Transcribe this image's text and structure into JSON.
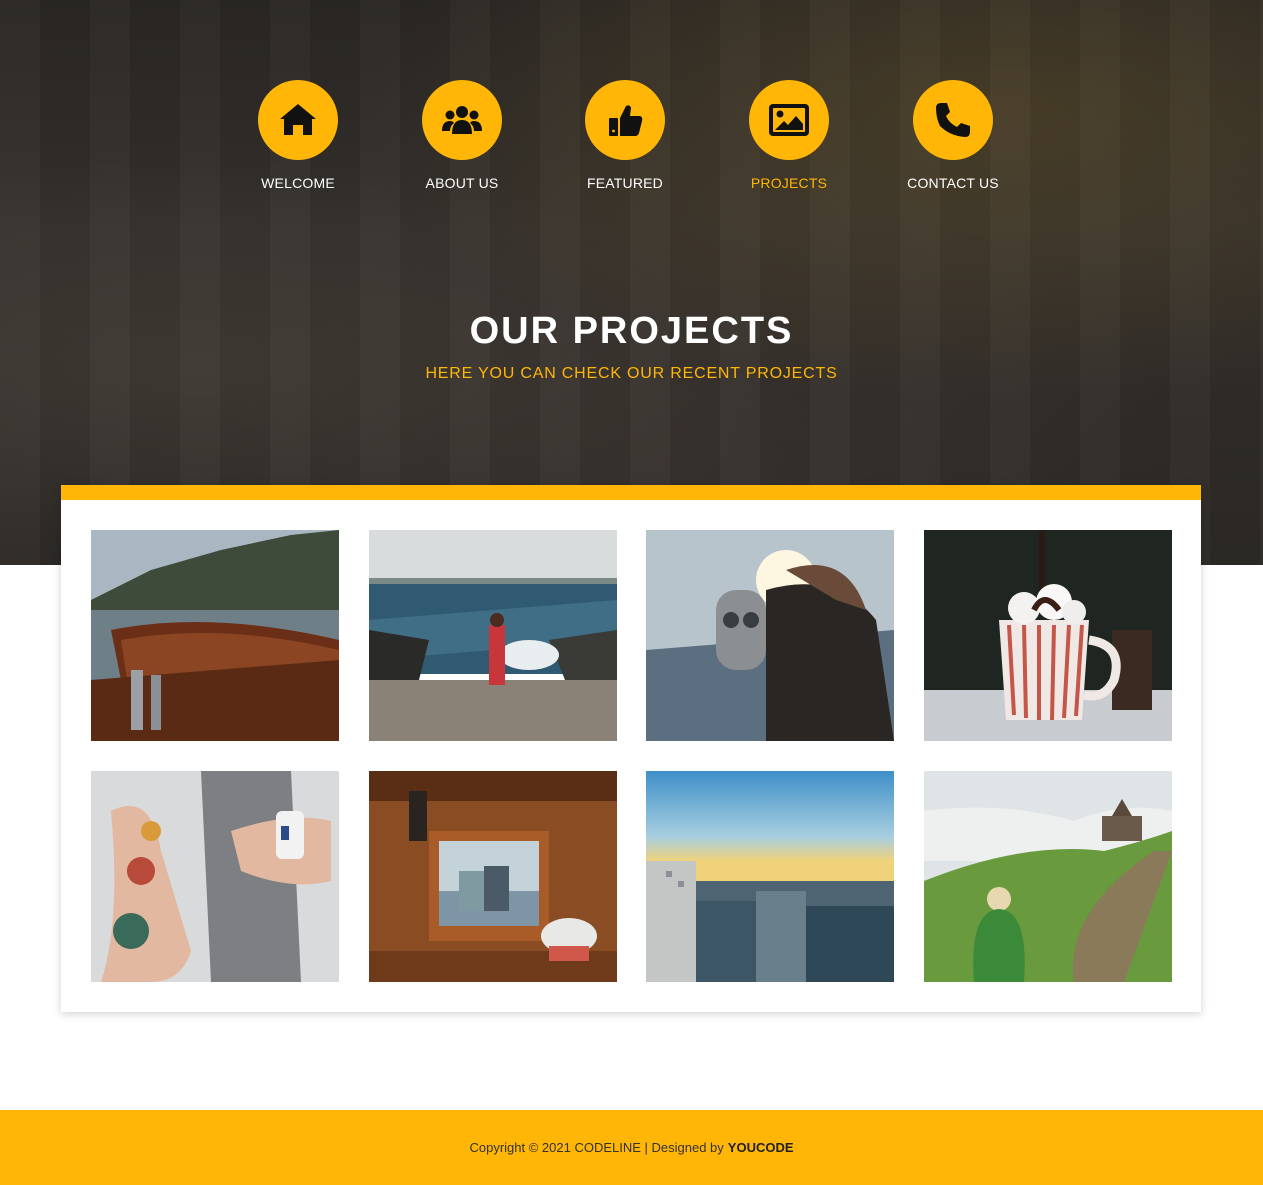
{
  "nav": {
    "items": [
      {
        "label": "WELCOME",
        "icon": "home-icon"
      },
      {
        "label": "ABOUT US",
        "icon": "users-icon"
      },
      {
        "label": "FEATURED",
        "icon": "thumbs-up-icon"
      },
      {
        "label": "PROJECTS",
        "icon": "image-icon",
        "active": true
      },
      {
        "label": "CONTACT US",
        "icon": "phone-icon"
      }
    ]
  },
  "hero": {
    "title": "OUR PROJECTS",
    "subtitle": "HERE YOU CAN CHECK OUR RECENT PROJECTS"
  },
  "gallery": {
    "items": [
      {
        "subject": "wooden boat with chains by lake"
      },
      {
        "subject": "woman running on rocky seashore"
      },
      {
        "subject": "person at observation binoculars"
      },
      {
        "subject": "hot chocolate mug with marshmallows"
      },
      {
        "subject": "tattooed woman holding mug"
      },
      {
        "subject": "couple seen through boat window"
      },
      {
        "subject": "city skyline at sunset"
      },
      {
        "subject": "hiker looking at hills and church"
      }
    ]
  },
  "footer": {
    "text": "Copyright © 2021 CODELINE | Designed by",
    "link": "YOUCODE"
  },
  "colors": {
    "accent": "#ffb606",
    "hero_bg": "#2e2b28",
    "white": "#ffffff"
  }
}
